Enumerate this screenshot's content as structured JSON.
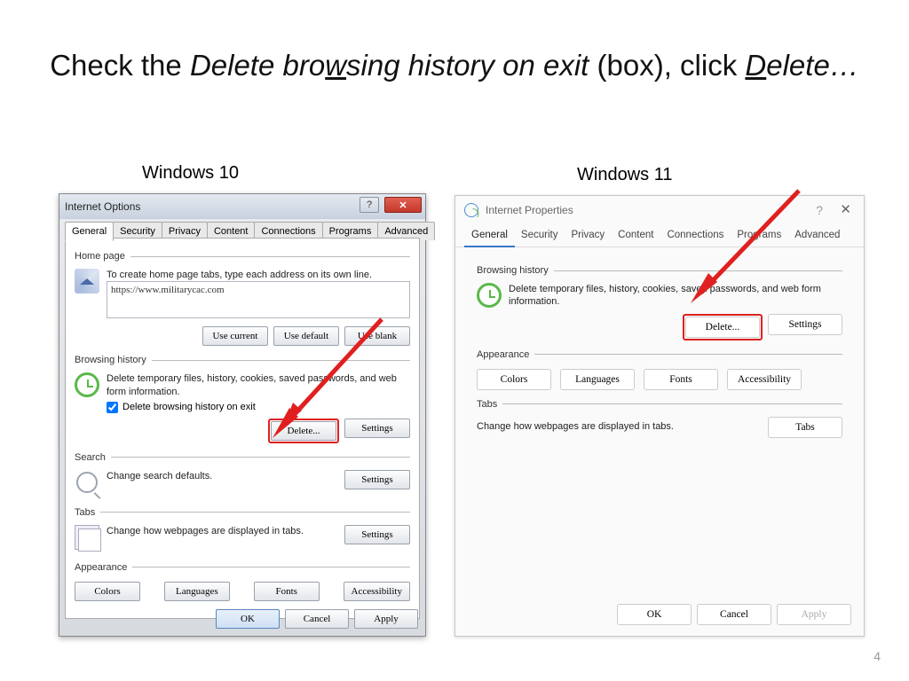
{
  "slide": {
    "title_pre": "Check the ",
    "title_em1": "Delete bro",
    "title_em1u": "w",
    "title_em1b": "sing history on exit",
    "title_mid": " (box), click ",
    "title_em2u": "D",
    "title_em2": "elete…",
    "os10": "Windows 10",
    "os11": "Windows 11",
    "page": "4"
  },
  "win10": {
    "title": "Internet Options",
    "tabs": [
      "General",
      "Security",
      "Privacy",
      "Content",
      "Connections",
      "Programs",
      "Advanced"
    ],
    "homepage_legend": "Home page",
    "homepage_desc": "To create home page tabs, type each address on its own line.",
    "homepage_url": "https://www.militarycac.com",
    "use_current": "Use current",
    "use_default": "Use default",
    "use_blank": "Use blank",
    "history_legend": "Browsing history",
    "history_desc": "Delete temporary files, history, cookies, saved passwords, and web form information.",
    "history_chk": "Delete browsing history on exit",
    "delete_btn": "Delete...",
    "settings_btn": "Settings",
    "search_legend": "Search",
    "search_desc": "Change search defaults.",
    "tabs_legend": "Tabs",
    "tabs_desc": "Change how webpages are displayed in tabs.",
    "appearance_legend": "Appearance",
    "colors": "Colors",
    "languages": "Languages",
    "fonts": "Fonts",
    "accessibility": "Accessibility",
    "ok": "OK",
    "cancel": "Cancel",
    "apply": "Apply"
  },
  "win11": {
    "title": "Internet Properties",
    "tabs": [
      "General",
      "Security",
      "Privacy",
      "Content",
      "Connections",
      "Programs",
      "Advanced"
    ],
    "history_legend": "Browsing history",
    "history_desc": "Delete temporary files, history, cookies, saved passwords, and web form information.",
    "delete_btn": "Delete...",
    "settings_btn": "Settings",
    "appearance_legend": "Appearance",
    "colors": "Colors",
    "languages": "Languages",
    "fonts": "Fonts",
    "accessibility": "Accessibility",
    "tabs_legend": "Tabs",
    "tabs_desc": "Change how webpages are displayed in tabs.",
    "tabs_btn": "Tabs",
    "ok": "OK",
    "cancel": "Cancel",
    "apply": "Apply"
  }
}
